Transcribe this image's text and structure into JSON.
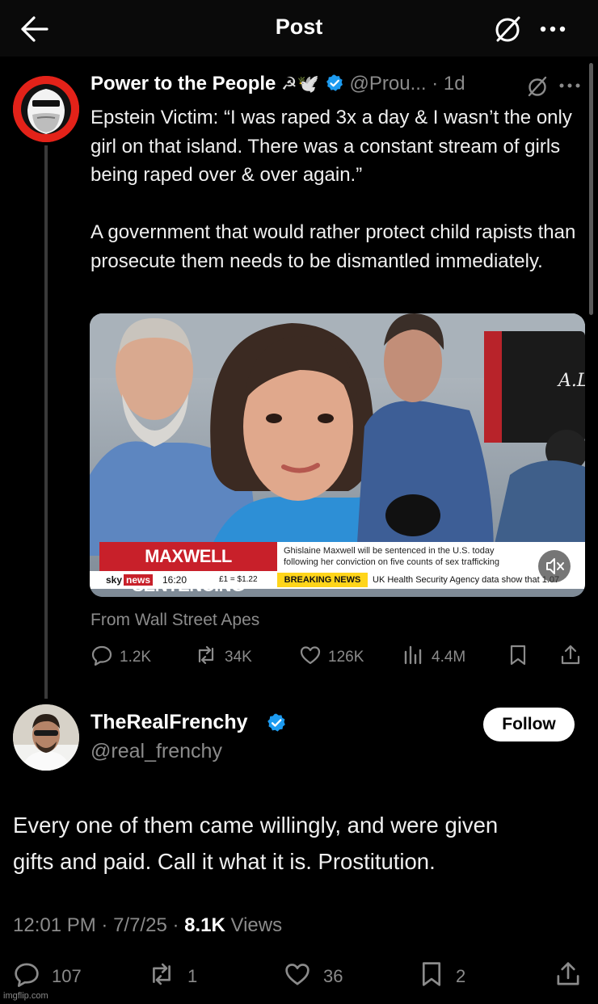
{
  "header": {
    "title": "Post",
    "back_icon": "arrow-left-icon",
    "grok_icon": "grok-icon",
    "more_icon": "more-horizontal-icon"
  },
  "quoted_post": {
    "author_name": "Power to the People",
    "author_flair": "☭🕊️",
    "handle": "@Prou...",
    "time": "1d",
    "text": "Epstein Victim: “I was raped 3x a day & I wasn’t the only girl on that island. There was a constant stream of girls being raped over & over again.”\n\nA government that would rather protect child rapists than prosecute them needs to be dismantled immediately.",
    "media": {
      "banner": "MAXWELL SENTENCING",
      "subtitle_line1": "Ghislaine Maxwell will be sentenced in the U.S. today",
      "subtitle_line2": "following her conviction on five counts of sex trafficking",
      "channel_sky": "sky",
      "channel_news": "news",
      "clock": "16:20",
      "fx": "£1 = $1.22",
      "breaking": "BREAKING NEWS",
      "ticker": "UK Health Security Agency data show that 1.07",
      "graphic_brand": "A.L"
    },
    "from_label": "From Wall Street Apes",
    "actions": {
      "replies": "1.2K",
      "reposts": "34K",
      "likes": "126K",
      "views": "4.4M"
    }
  },
  "reply_post": {
    "author_name": "TheRealFrenchy",
    "handle": "@real_frenchy",
    "follow_label": "Follow",
    "text": "Every one of them came willingly, and were given\ngifts and paid.  Call it what it is.  Prostitution.",
    "time": "12:01 PM",
    "date": "7/7/25",
    "views_count": "8.1K",
    "views_label": "Views",
    "actions": {
      "replies": "107",
      "reposts": "1",
      "likes": "36",
      "bookmarks": "2"
    }
  },
  "watermark": "imgflip.com",
  "colors": {
    "background": "#000000",
    "verified": "#1d9bf0",
    "muted_text": "#8b8b8b",
    "sky_red": "#c8202a",
    "breaking_yellow": "#ffd51a"
  }
}
